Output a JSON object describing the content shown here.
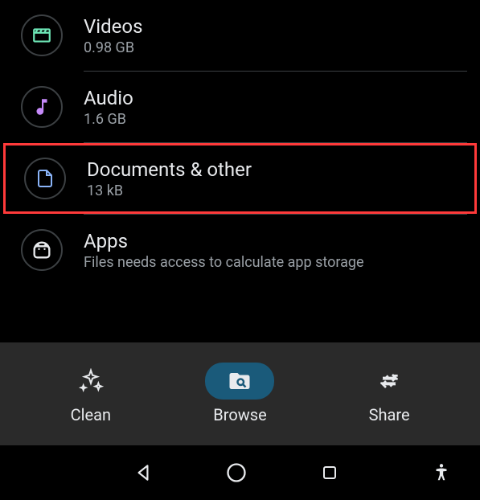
{
  "categories": [
    {
      "id": "videos",
      "label": "Videos",
      "sub": "0.98 GB",
      "icon": "clapperboard-icon",
      "color": "#6ee7b7"
    },
    {
      "id": "audio",
      "label": "Audio",
      "sub": "1.6 GB",
      "icon": "music-note-icon",
      "color": "#c58af9"
    },
    {
      "id": "documents",
      "label": "Documents & other",
      "sub": "13 kB",
      "icon": "document-icon",
      "color": "#8ab4f8",
      "highlighted": true
    },
    {
      "id": "apps",
      "label": "Apps",
      "sub": "Files needs access to calculate app storage",
      "icon": "android-icon",
      "color": "#e8eaed"
    }
  ],
  "nav": {
    "clean": "Clean",
    "browse": "Browse",
    "share": "Share",
    "active": "browse"
  }
}
